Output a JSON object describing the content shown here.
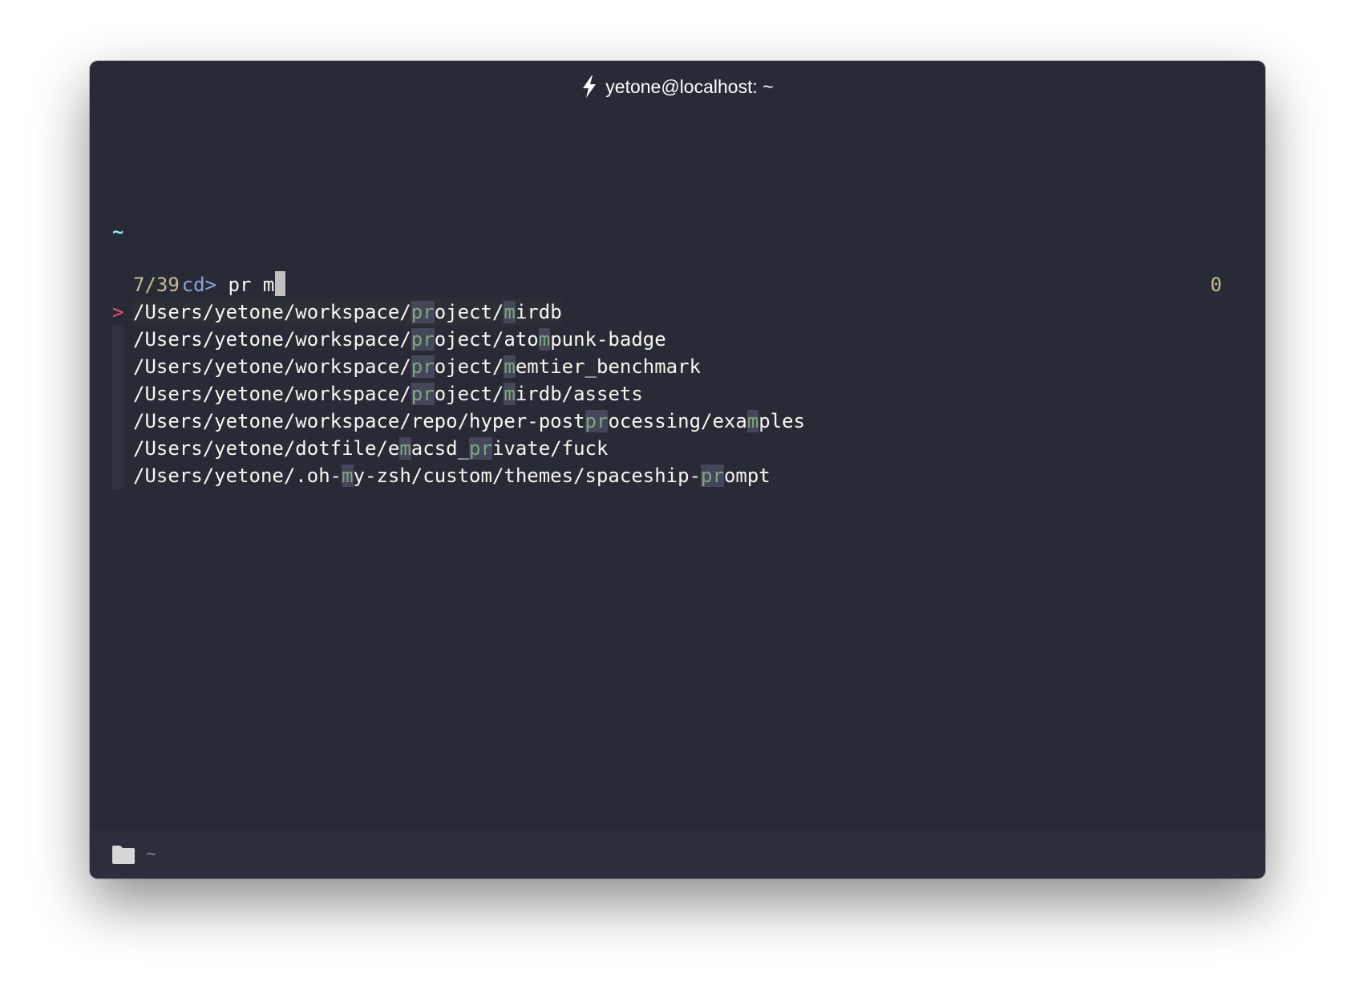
{
  "window": {
    "title": "yetone@localhost: ~",
    "title_icon": "lightning-bolt-icon"
  },
  "terminal": {
    "cwd_line": "~",
    "prompt_label": "cd>",
    "query": "pr m",
    "match_count": "7/39",
    "right_count": "0",
    "pointer": ">",
    "results": [
      {
        "segments": [
          [
            "/Users/yetone/workspace/",
            false
          ],
          [
            "pr",
            true
          ],
          [
            "oject/",
            false
          ],
          [
            "m",
            true
          ],
          [
            "irdb",
            false
          ]
        ],
        "selected": true
      },
      {
        "segments": [
          [
            "/Users/yetone/workspace/",
            false
          ],
          [
            "pr",
            true
          ],
          [
            "oject/ato",
            false
          ],
          [
            "m",
            true
          ],
          [
            "punk-badge",
            false
          ]
        ],
        "selected": false
      },
      {
        "segments": [
          [
            "/Users/yetone/workspace/",
            false
          ],
          [
            "pr",
            true
          ],
          [
            "oject/",
            false
          ],
          [
            "m",
            true
          ],
          [
            "emtier_benchmark",
            false
          ]
        ],
        "selected": false
      },
      {
        "segments": [
          [
            "/Users/yetone/workspace/",
            false
          ],
          [
            "pr",
            true
          ],
          [
            "oject/",
            false
          ],
          [
            "m",
            true
          ],
          [
            "irdb/assets",
            false
          ]
        ],
        "selected": false
      },
      {
        "segments": [
          [
            "/Users/yetone/workspace/repo/hyper-post",
            false
          ],
          [
            "pr",
            true
          ],
          [
            "ocessing/exa",
            false
          ],
          [
            "m",
            true
          ],
          [
            "ples",
            false
          ]
        ],
        "selected": false
      },
      {
        "segments": [
          [
            "/Users/yetone/dotfile/e",
            false
          ],
          [
            "m",
            true
          ],
          [
            "acsd_",
            false
          ],
          [
            "pr",
            true
          ],
          [
            "ivate/fuck",
            false
          ]
        ],
        "selected": false
      },
      {
        "segments": [
          [
            "/Users/yetone/.oh-",
            false
          ],
          [
            "m",
            true
          ],
          [
            "y-zsh/custom/themes/spaceship-",
            false
          ],
          [
            "pr",
            true
          ],
          [
            "ompt",
            false
          ]
        ],
        "selected": false
      }
    ]
  },
  "statusbar": {
    "icon": "folder-icon",
    "cwd": "~"
  },
  "colors": {
    "background": "#282a36",
    "prompt": "#8ea4d8",
    "tilde": "#8be9fd",
    "count": "#c4bf92",
    "pointer": "#ff4a6e",
    "match_highlight_bg": "#44475a",
    "match_highlight_fg": "#7fa67f"
  }
}
